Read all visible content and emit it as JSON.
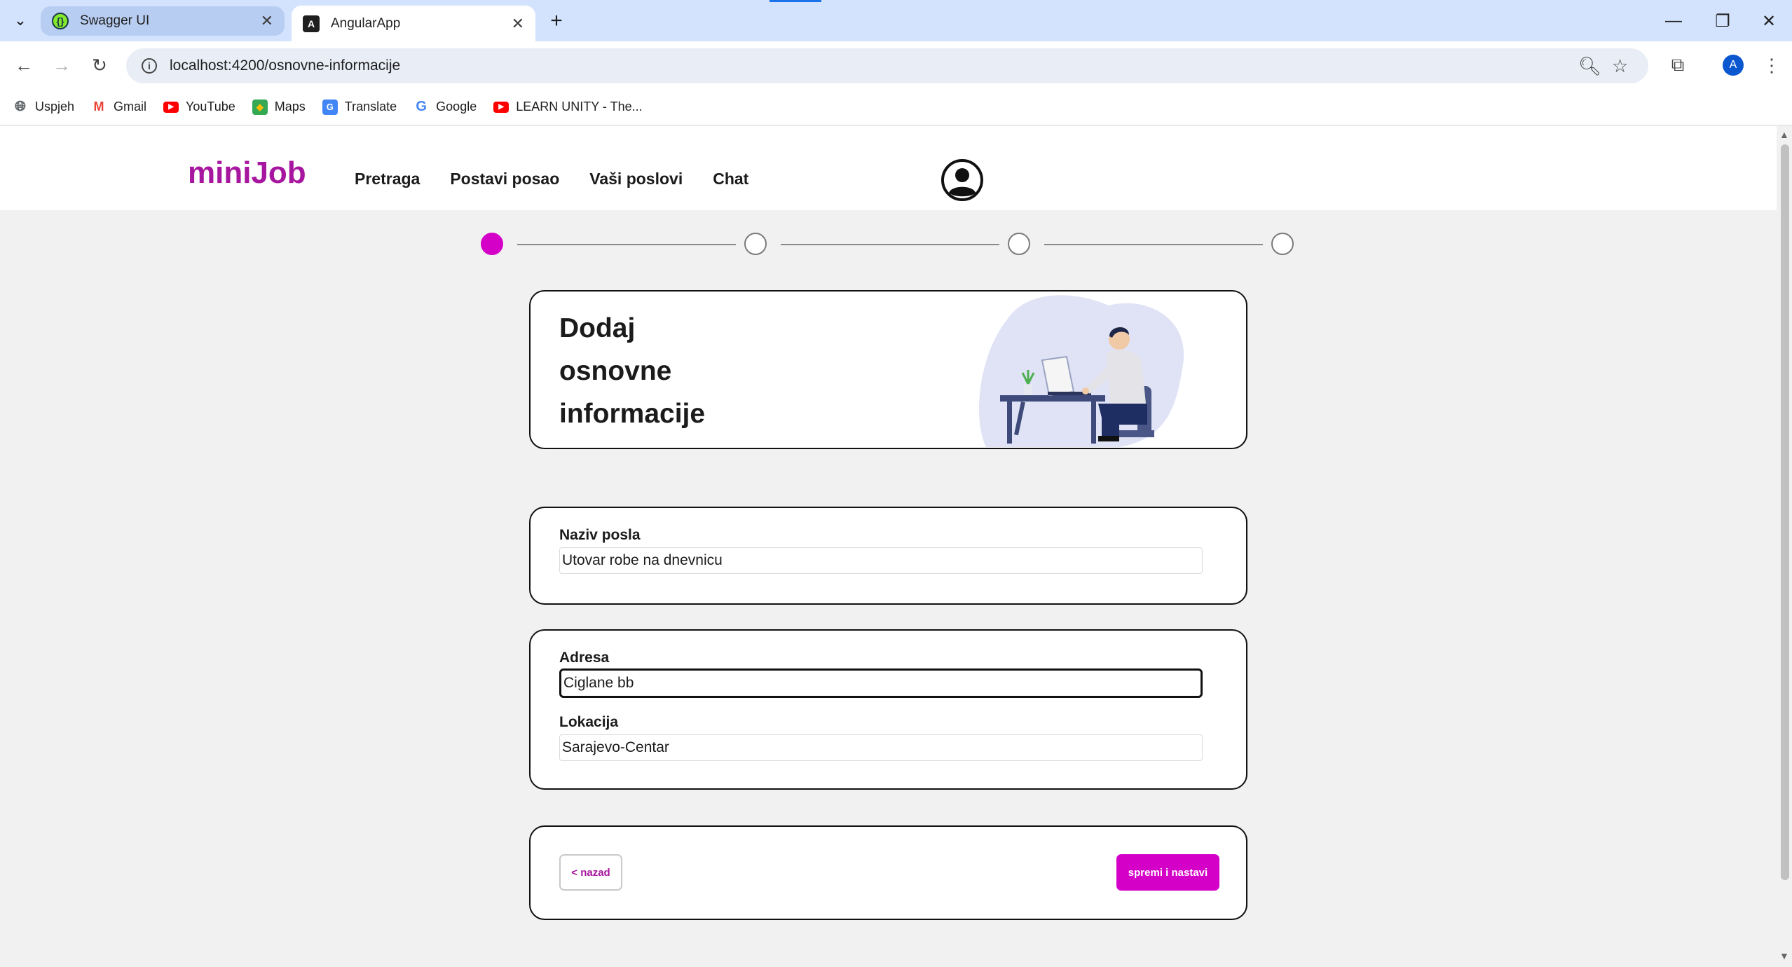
{
  "browser": {
    "tabs": [
      {
        "title": "Swagger UI",
        "favicon": "swagger-icon",
        "active": false
      },
      {
        "title": "AngularApp",
        "favicon": "angular-icon",
        "active": true
      }
    ],
    "url": "localhost:4200/osnovne-informacije",
    "profile_initial": "A",
    "bookmarks": [
      {
        "label": "Uspjeh",
        "icon": "globe-icon"
      },
      {
        "label": "Gmail",
        "icon": "gmail-icon"
      },
      {
        "label": "YouTube",
        "icon": "youtube-icon"
      },
      {
        "label": "Maps",
        "icon": "maps-icon"
      },
      {
        "label": "Translate",
        "icon": "translate-icon"
      },
      {
        "label": "Google",
        "icon": "google-icon"
      },
      {
        "label": "LEARN UNITY - The...",
        "icon": "youtube-icon"
      }
    ]
  },
  "app": {
    "logo": "miniJob",
    "nav": [
      "Pretraga",
      "Postavi posao",
      "Vaši poslovi",
      "Chat"
    ],
    "stepper": {
      "total_steps": 4,
      "current_step": 1
    },
    "title_lines": [
      "Dodaj",
      "osnovne",
      "informacije"
    ],
    "job_card": {
      "label": "Naziv posla",
      "value": "Utovar robe na dnevnicu"
    },
    "address_card": {
      "address_label": "Adresa",
      "address_value": "Ciglane bb",
      "location_label": "Lokacija",
      "location_value": "Sarajevo-Centar"
    },
    "actions": {
      "back_label": "< nazad",
      "next_label": "spremi i nastavi"
    },
    "colors": {
      "brand": "#a7169e",
      "accent": "#d400c8"
    }
  }
}
